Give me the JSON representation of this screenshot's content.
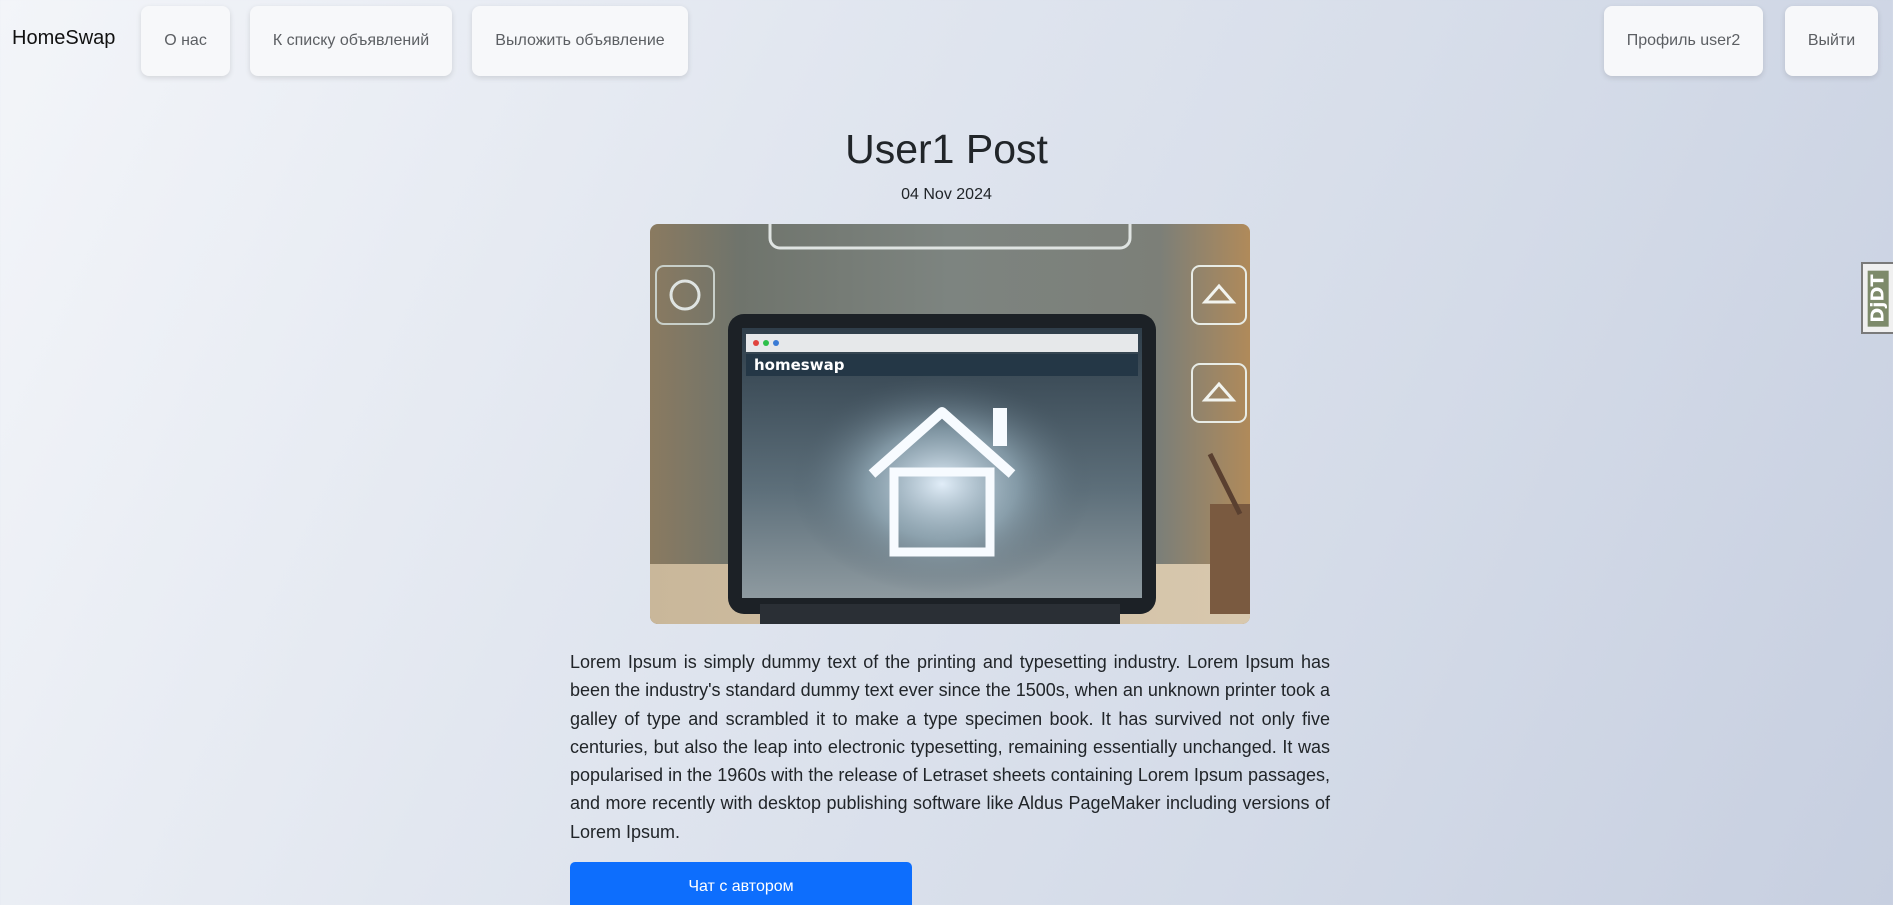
{
  "navbar": {
    "brand": "HomeSwap",
    "about_label": "О нас",
    "list_label": "К списку объявлений",
    "post_label": "Выложить объявление",
    "profile_label": "Профиль user2",
    "logout_label": "Выйти"
  },
  "post": {
    "title": "User1 Post",
    "date": "04 Nov 2024",
    "image_text": "homeswap",
    "body": "Lorem Ipsum is simply dummy text of the printing and typesetting industry. Lorem Ipsum has been the industry's standard dummy text ever since the 1500s, when an unknown printer took a galley of type and scrambled it to make a type specimen book. It has survived not only five centuries, but also the leap into electronic typesetting, remaining essentially unchanged. It was popularised in the 1960s with the release of Letraset sheets containing Lorem Ipsum passages, and more recently with desktop publishing software like Aldus PageMaker including versions of Lorem Ipsum.",
    "chat_button": "Чат с автором"
  },
  "debug_toolbar": {
    "label": "DjDT"
  },
  "colors": {
    "primary": "#0d6efd",
    "nav_button_bg": "#f7f8fa",
    "nav_text": "#5c5f63"
  }
}
